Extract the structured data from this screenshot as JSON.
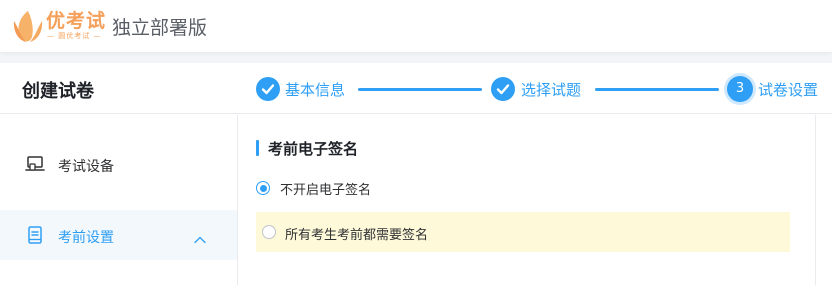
{
  "brand": {
    "logo_name": "优考试",
    "logo_sub": "— 圆优考试 —",
    "edition": "独立部署版",
    "accent": "#f5a05a"
  },
  "header": {
    "title": "创建试卷"
  },
  "steps": [
    {
      "label": "基本信息",
      "status": "done",
      "icon": "check-icon"
    },
    {
      "label": "选择试题",
      "status": "done",
      "icon": "check-icon"
    },
    {
      "label": "试卷设置",
      "status": "current",
      "number": "3"
    }
  ],
  "sidebar": {
    "items": [
      {
        "label": "考试设备",
        "icon": "device-icon",
        "active": false
      },
      {
        "label": "考前设置",
        "icon": "book-icon",
        "active": true,
        "expanded": true
      }
    ]
  },
  "section": {
    "title": "考前电子签名",
    "options": [
      {
        "label": "不开启电子签名",
        "selected": true
      },
      {
        "label": "所有考生考前都需要签名",
        "selected": false
      }
    ]
  },
  "colors": {
    "primary": "#2f9ff5",
    "highlight": "#fdf9d9"
  }
}
